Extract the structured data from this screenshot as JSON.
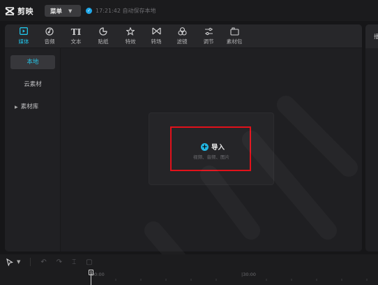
{
  "app": {
    "title": "剪映",
    "menu_label": "菜单",
    "save_status": "17:21:42 自动保存本地"
  },
  "toolbar": {
    "tabs": [
      {
        "label": "媒体",
        "icon": "media-icon",
        "active": true
      },
      {
        "label": "音频",
        "icon": "audio-icon",
        "active": false
      },
      {
        "label": "文本",
        "icon": "text-icon",
        "active": false
      },
      {
        "label": "贴纸",
        "icon": "sticker-icon",
        "active": false
      },
      {
        "label": "特效",
        "icon": "effects-icon",
        "active": false
      },
      {
        "label": "转场",
        "icon": "transition-icon",
        "active": false
      },
      {
        "label": "滤镜",
        "icon": "filter-icon",
        "active": false
      },
      {
        "label": "调节",
        "icon": "adjust-icon",
        "active": false
      },
      {
        "label": "素材包",
        "icon": "material-pack-icon",
        "active": false
      }
    ],
    "text_glyph": "TI"
  },
  "sidenav": {
    "items": [
      {
        "label": "本地",
        "active": true
      },
      {
        "label": "云素材",
        "active": false
      },
      {
        "label": "素材库",
        "active": false,
        "expandable": true
      }
    ]
  },
  "import": {
    "button_label": "导入",
    "hint": "视频、音频、图片"
  },
  "player": {
    "header_char": "播"
  },
  "timeline": {
    "time_start": "00:00",
    "time_mark": "|30:00"
  },
  "colors": {
    "accent": "#21c3e8",
    "highlight_box": "#e2111a",
    "background": "#161618",
    "panel": "#1f1f22"
  }
}
